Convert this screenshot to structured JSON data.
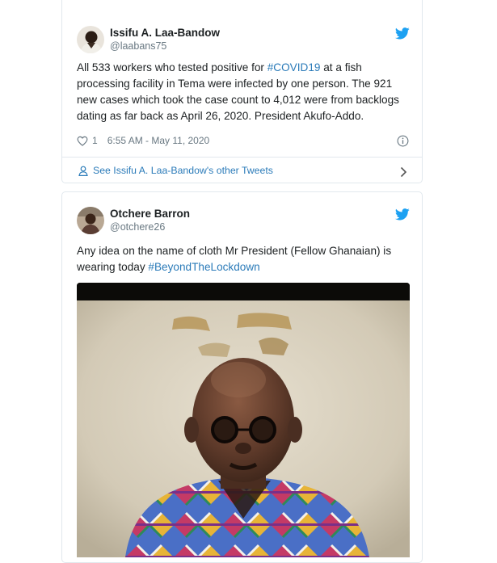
{
  "tweets": [
    {
      "name": "Issifu A. Laa-Bandow",
      "handle": "@laabans75",
      "text_parts": [
        "All 533 workers who tested positive for ",
        "#COVID19",
        " at a fish processing facility in Tema were infected by one person. The 921 new cases which took the case count to 4,012 were  from backlogs dating as far back as April 26, 2020. President Akufo-Addo."
      ],
      "likes": "1",
      "timestamp": "6:55 AM - May 11, 2020",
      "more_link": "See Issifu A. Laa-Bandow's other Tweets"
    },
    {
      "name": "Otchere Barron",
      "handle": "@otchere26",
      "text_parts": [
        "Any idea on the name of cloth Mr President (Fellow Ghanaian) is wearing today ",
        "#BeyondTheLockdown"
      ]
    }
  ],
  "icons": {
    "brand": "twitter-bird-icon",
    "like": "heart-icon",
    "info": "info-icon",
    "person": "person-icon",
    "chevron": "chevron-right-icon"
  },
  "colors": {
    "link": "#2b7bb9",
    "bird": "#1da1f2",
    "muted": "#697882",
    "border": "#e1e8ed"
  }
}
